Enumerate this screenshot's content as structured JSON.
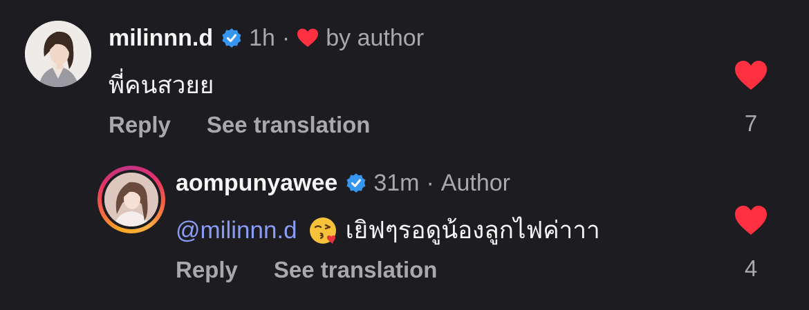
{
  "colors": {
    "background": "#1c1c21",
    "like_red": "#ff3040",
    "verified_blue": "#3797f0",
    "mention_blue": "#8a9cf5",
    "muted_text": "#a8a8ad"
  },
  "comments": [
    {
      "username": "milinnn.d",
      "verified": true,
      "time": "1h",
      "liked_by_author_icon": "heart-icon",
      "liked_by_author_label": "by author",
      "text": "พี่คนสวยย",
      "reply_label": "Reply",
      "translate_label": "See translation",
      "likes": "7",
      "liked": true
    },
    {
      "username": "aompunyawee",
      "verified": true,
      "time": "31m",
      "author_badge": "Author",
      "mention": "@milinnn.d",
      "emoji": "face-blowing-a-kiss",
      "text": "เยิฟๆรอดูน้องลูกไฟค่าาา",
      "reply_label": "Reply",
      "translate_label": "See translation",
      "likes": "4",
      "liked": true,
      "has_story_ring": true
    }
  ]
}
